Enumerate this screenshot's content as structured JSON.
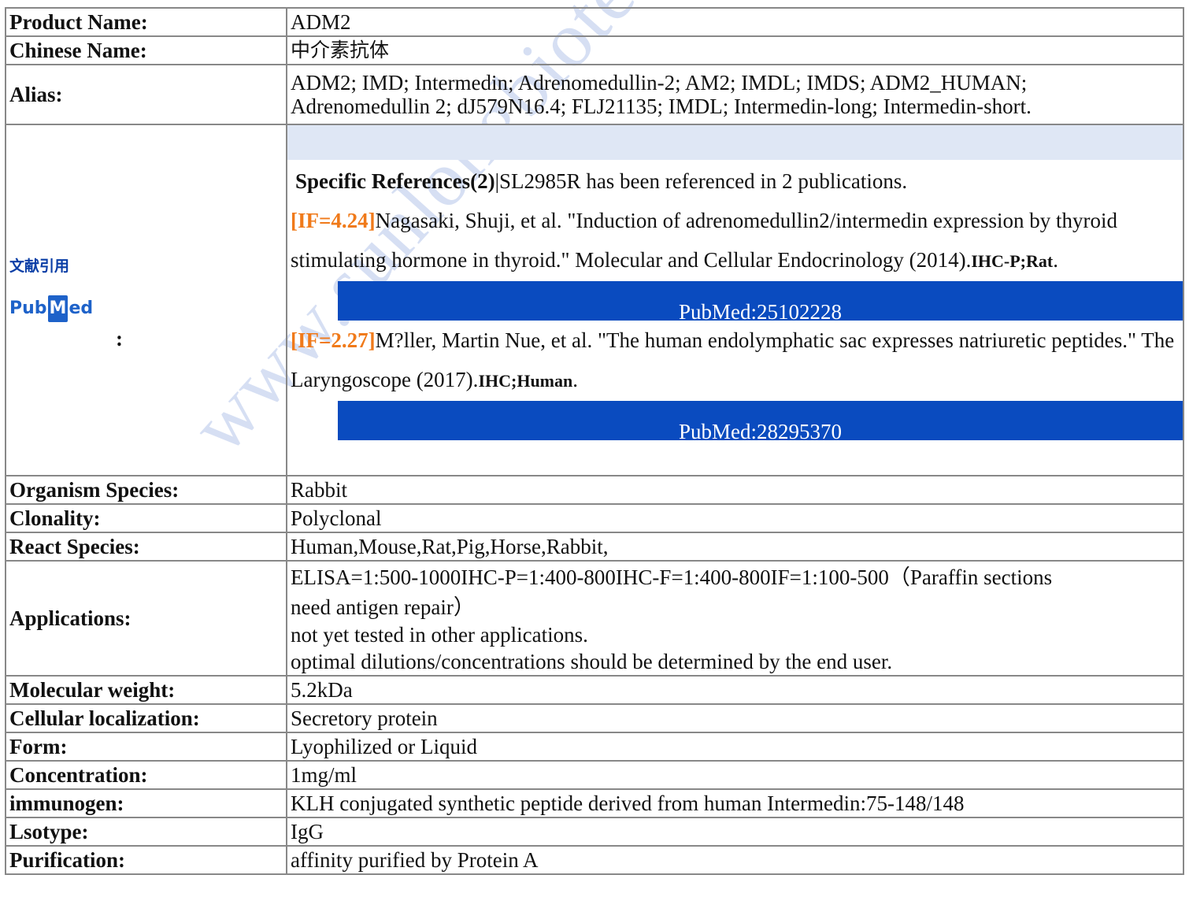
{
  "watermark": "www.sunlongbiotech.com",
  "rows_top": [
    {
      "label": "Product Name:",
      "value": "ADM2",
      "cjk": false
    },
    {
      "label": "Chinese Name:",
      "value": "中介素抗体",
      "cjk": true
    }
  ],
  "alias": {
    "label": "Alias:",
    "line1": "ADM2; IMD; Intermedin; Adrenomedullin-2; AM2; IMDL; IMDS; ADM2_HUMAN;",
    "line2": "Adrenomedullin 2; dJ579N16.4; FLJ21135; IMDL; Intermedin-long; Intermedin-short."
  },
  "references": {
    "label_title": "文献引用",
    "logo_text": {
      "a": "Pub",
      "b": "M",
      "c": "ed"
    },
    "colon": ":",
    "header_bold": "Specific References(2)",
    "header_rest": "|SL2985R has been referenced in 2 publications.",
    "items": [
      {
        "if": "[IF=4.24]",
        "text": "Nagasaki, Shuji, et al. \"Induction of adrenomedullin2/intermedin expression by thyroid stimulating hormone in thyroid.\" Molecular and Cellular Endocrinology (2014).",
        "tags": "IHC-P;Rat",
        "tail": ".",
        "pubmed": "PubMed:25102228"
      },
      {
        "if": "[IF=2.27]",
        "text": "M?ller, Martin Nue, et al. \"The human endolymphatic sac expresses natriuretic peptides.\" The Laryngoscope (2017).",
        "tags": "IHC;Human",
        "tail": ".",
        "pubmed": "PubMed:28295370"
      }
    ]
  },
  "rows_mid": [
    {
      "label": "Organism Species:",
      "value": "Rabbit"
    },
    {
      "label": "Clonality:",
      "value": "Polyclonal"
    },
    {
      "label": "React Species:",
      "value": "Human,Mouse,Rat,Pig,Horse,Rabbit,"
    }
  ],
  "applications": {
    "label": "Applications:",
    "line1": "ELISA=1:500-1000IHC-P=1:400-800IHC-F=1:400-800IF=1:100-500（Paraffin sections",
    "line2": "need antigen repair）",
    "line3": "not yet tested in other applications.",
    "line4": "optimal dilutions/concentrations should be determined by the end user."
  },
  "rows_bottom": [
    {
      "label": "Molecular weight:",
      "value": "5.2kDa"
    },
    {
      "label": "Cellular localization:",
      "value": "Secretory protein"
    },
    {
      "label": "Form:",
      "value": "Lyophilized or Liquid"
    },
    {
      "label": "Concentration:",
      "value": "1mg/ml"
    },
    {
      "label": "immunogen:",
      "value": "KLH conjugated synthetic peptide derived from human Intermedin:75-148/148"
    },
    {
      "label": "Lsotype:",
      "value": "IgG"
    },
    {
      "label": "Purification:",
      "value": "affinity purified by Protein A"
    }
  ]
}
